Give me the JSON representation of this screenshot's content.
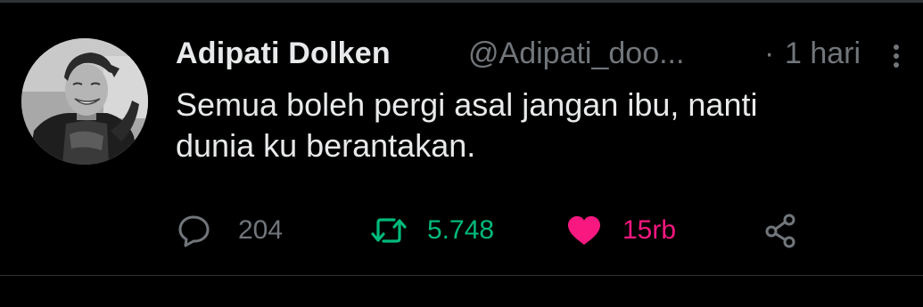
{
  "tweet": {
    "author": {
      "display_name": "Adipati Dolken",
      "handle": "@Adipati_doo...",
      "avatar_icon": "profile-photo"
    },
    "separator": "·",
    "timestamp": "1 hari",
    "text_lines": [
      "Semua boleh pergi asal jangan ibu, nanti",
      "dunia ku berantakan."
    ],
    "actions": {
      "reply": {
        "icon": "speech-bubble-icon",
        "count": "204"
      },
      "retweet": {
        "icon": "retweet-arrows-icon",
        "count": "5.748",
        "active": true
      },
      "like": {
        "icon": "heart-icon",
        "count": "15rb",
        "active": true
      },
      "share": {
        "icon": "share-icon"
      }
    },
    "colors": {
      "background": "#000000",
      "text_primary": "#e7e9ea",
      "text_secondary": "#71767b",
      "retweet_active": "#00ba7c",
      "like_active": "#f91880",
      "border": "#2f3336"
    }
  }
}
